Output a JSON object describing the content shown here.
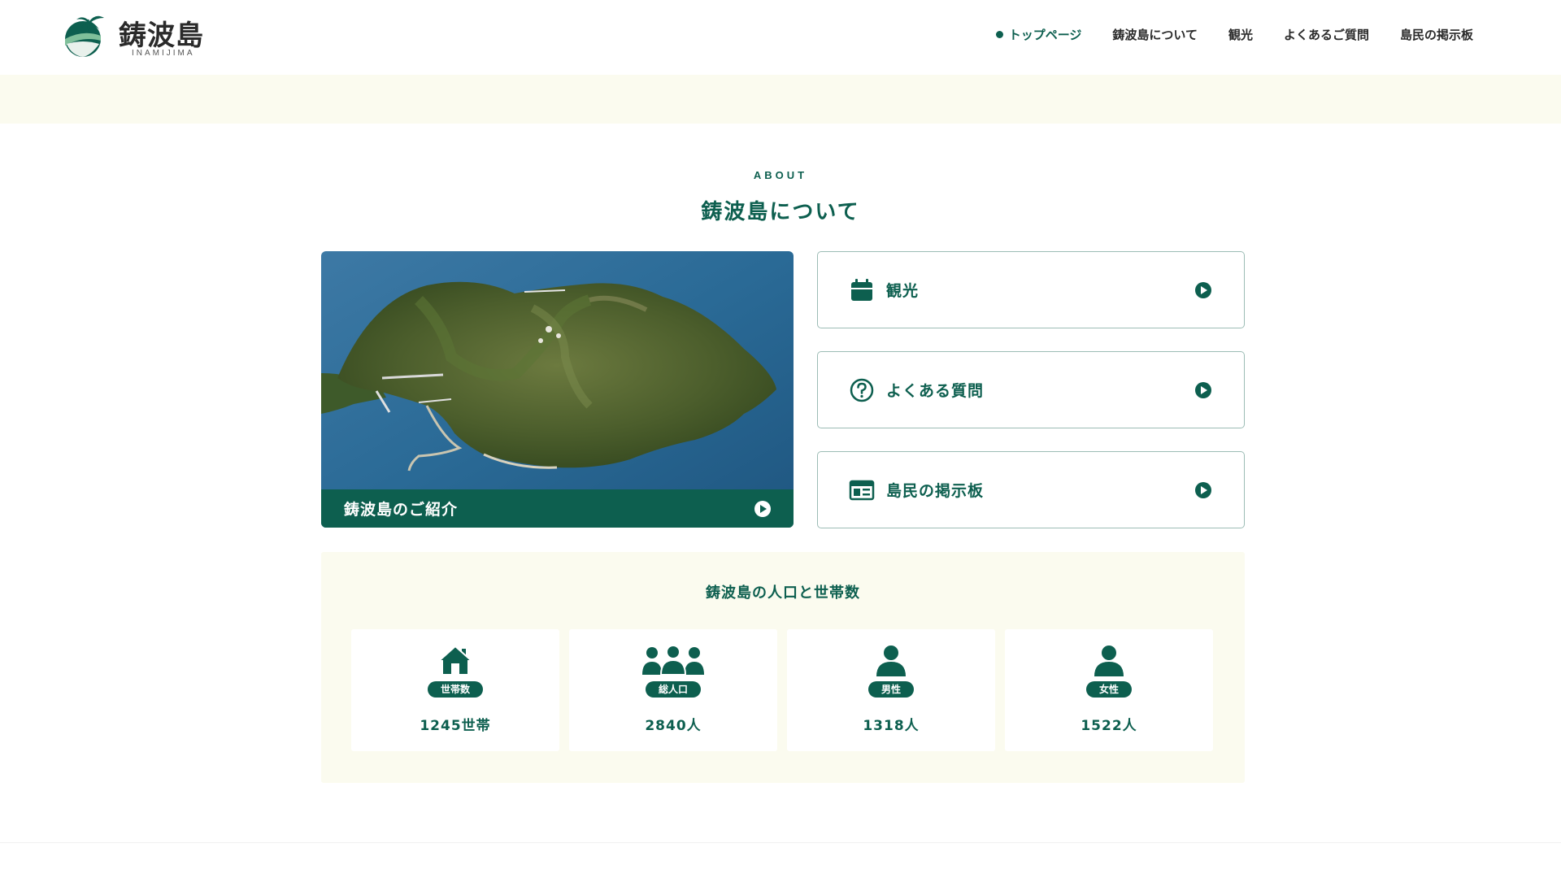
{
  "header": {
    "logo_title": "鋳波島",
    "logo_sub": "INAMIJIMA",
    "nav": [
      {
        "label": "トップページ",
        "active": true
      },
      {
        "label": "鋳波島について",
        "active": false
      },
      {
        "label": "観光",
        "active": false
      },
      {
        "label": "よくあるご質問",
        "active": false
      },
      {
        "label": "島民の掲示板",
        "active": false
      }
    ]
  },
  "about": {
    "eyebrow": "ABOUT",
    "title": "鋳波島について"
  },
  "intro_card": {
    "label": "鋳波島のご紹介",
    "icon": "play-circle-icon"
  },
  "link_cards": [
    {
      "label": "観光",
      "icon": "calendar-icon"
    },
    {
      "label": "よくある質問",
      "icon": "question-circle-icon"
    },
    {
      "label": "島民の掲示板",
      "icon": "board-icon"
    }
  ],
  "stats": {
    "title": "鋳波島の人口と世帯数",
    "items": [
      {
        "badge": "世帯数",
        "value": "1245世帯",
        "icon": "house-icon"
      },
      {
        "badge": "総人口",
        "value": "2840人",
        "icon": "group-icon"
      },
      {
        "badge": "男性",
        "value": "1318人",
        "icon": "person-icon"
      },
      {
        "badge": "女性",
        "value": "1522人",
        "icon": "person-icon"
      }
    ]
  },
  "colors": {
    "primary": "#0d5f4f",
    "cream": "#fbfbef",
    "border": "#9cbcb5"
  }
}
